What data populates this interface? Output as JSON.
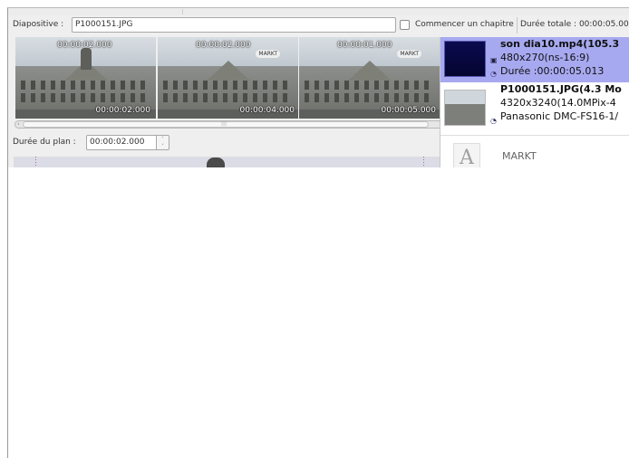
{
  "header": {
    "slide_label": "Diapositive :",
    "slide_value": "P1000151.JPG",
    "chapter_label": "Commencer un chapitre",
    "chapter_checked": false,
    "total_duration_label": "Durée totale : 00:00:05.00"
  },
  "thumbnails": [
    {
      "top_time": "00:00:02.000",
      "bottom_time": "00:00:02.000",
      "tag": "",
      "selected": true
    },
    {
      "top_time": "00:00:02.000",
      "bottom_time": "00:00:04.000",
      "tag": "MARKT",
      "selected": false
    },
    {
      "top_time": "00:00:01.000",
      "bottom_time": "00:00:05.000",
      "tag": "MARKT",
      "selected": false
    }
  ],
  "scrollbar": {
    "grip": "|||"
  },
  "shot_duration": {
    "label": "Durée du plan :",
    "value": "00:00:02.000",
    "stepper_up": "˄",
    "stepper_down": "˅"
  },
  "media_list": {
    "items": [
      {
        "title": "son dia10.mp4(105.3",
        "line1": "480x270(ns-16:9)",
        "line2": "Durée :00:00:05.013",
        "selected": true
      },
      {
        "title": "P1000151.JPG(4.3 Mo",
        "line1": "4320x3240(14.0MPix-4",
        "line2": "Panasonic DMC-FS16-1/",
        "selected": false
      },
      {
        "title": "",
        "line1": "MARKT",
        "line2": "",
        "selected": false
      }
    ]
  },
  "icons": {
    "film": "film-icon",
    "eye": "eye-icon",
    "photo": "photo-icon",
    "text": "text-A-icon"
  },
  "colors": {
    "selection_border": "#1020e0",
    "media_selected_bg": "#a7a9f0",
    "panel_bg": "#efefef"
  }
}
